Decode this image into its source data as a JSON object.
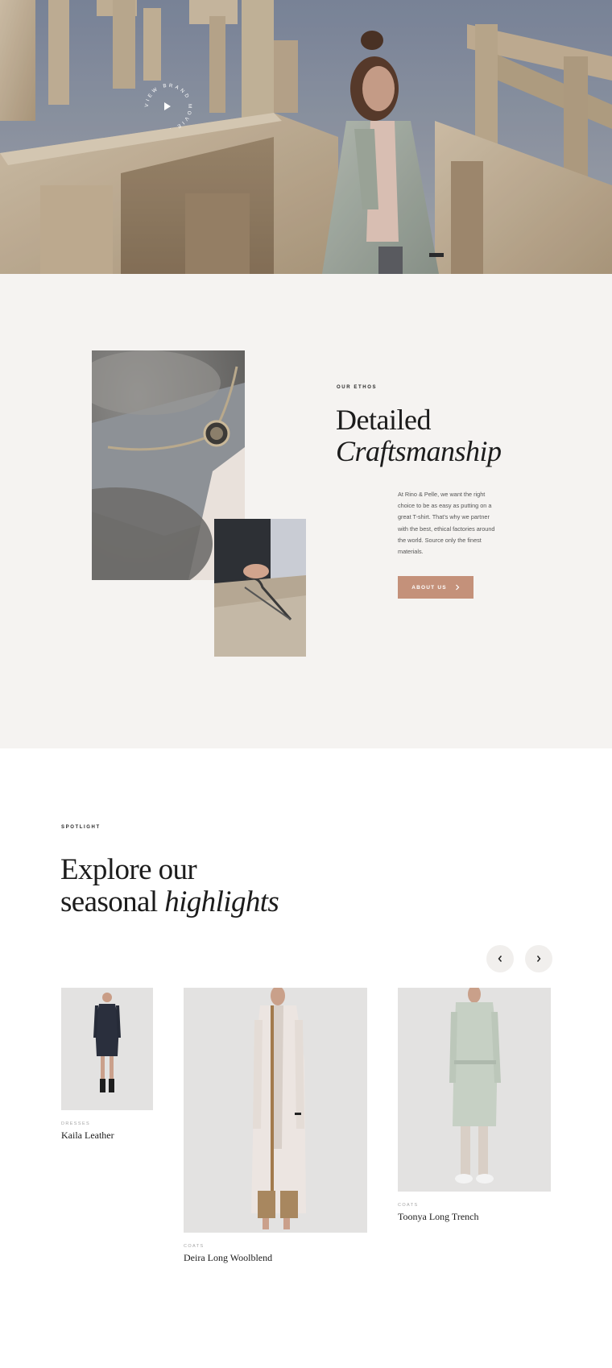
{
  "hero": {
    "badge_text": "VIEW BRAND MOVIE ·",
    "badge_icon": "play-icon"
  },
  "ethos": {
    "eyebrow": "OUR ETHOS",
    "title_line1": "Detailed",
    "title_line2": "Craftsmanship",
    "body": "At Rino & Pelle, we want the right choice to be as easy as putting on a great T-shirt. That's why we partner with the best, ethical factories around the world. Source only the finest materials.",
    "button_label": "ABOUT US",
    "button_icon": "chevron-right-icon",
    "accent_color": "#c4917a"
  },
  "spotlight": {
    "eyebrow": "SPOTLIGHT",
    "title_line1": "Explore our",
    "title_line2_plain": "seasonal",
    "title_line2_italic": "highlights",
    "prev_icon": "chevron-left-icon",
    "next_icon": "chevron-right-icon",
    "products": [
      {
        "category": "DRESSES",
        "name": "Kaila Leather"
      },
      {
        "category": "COATS",
        "name": "Deira Long Woolblend"
      },
      {
        "category": "COATS",
        "name": "Toonya Long Trench"
      }
    ]
  }
}
